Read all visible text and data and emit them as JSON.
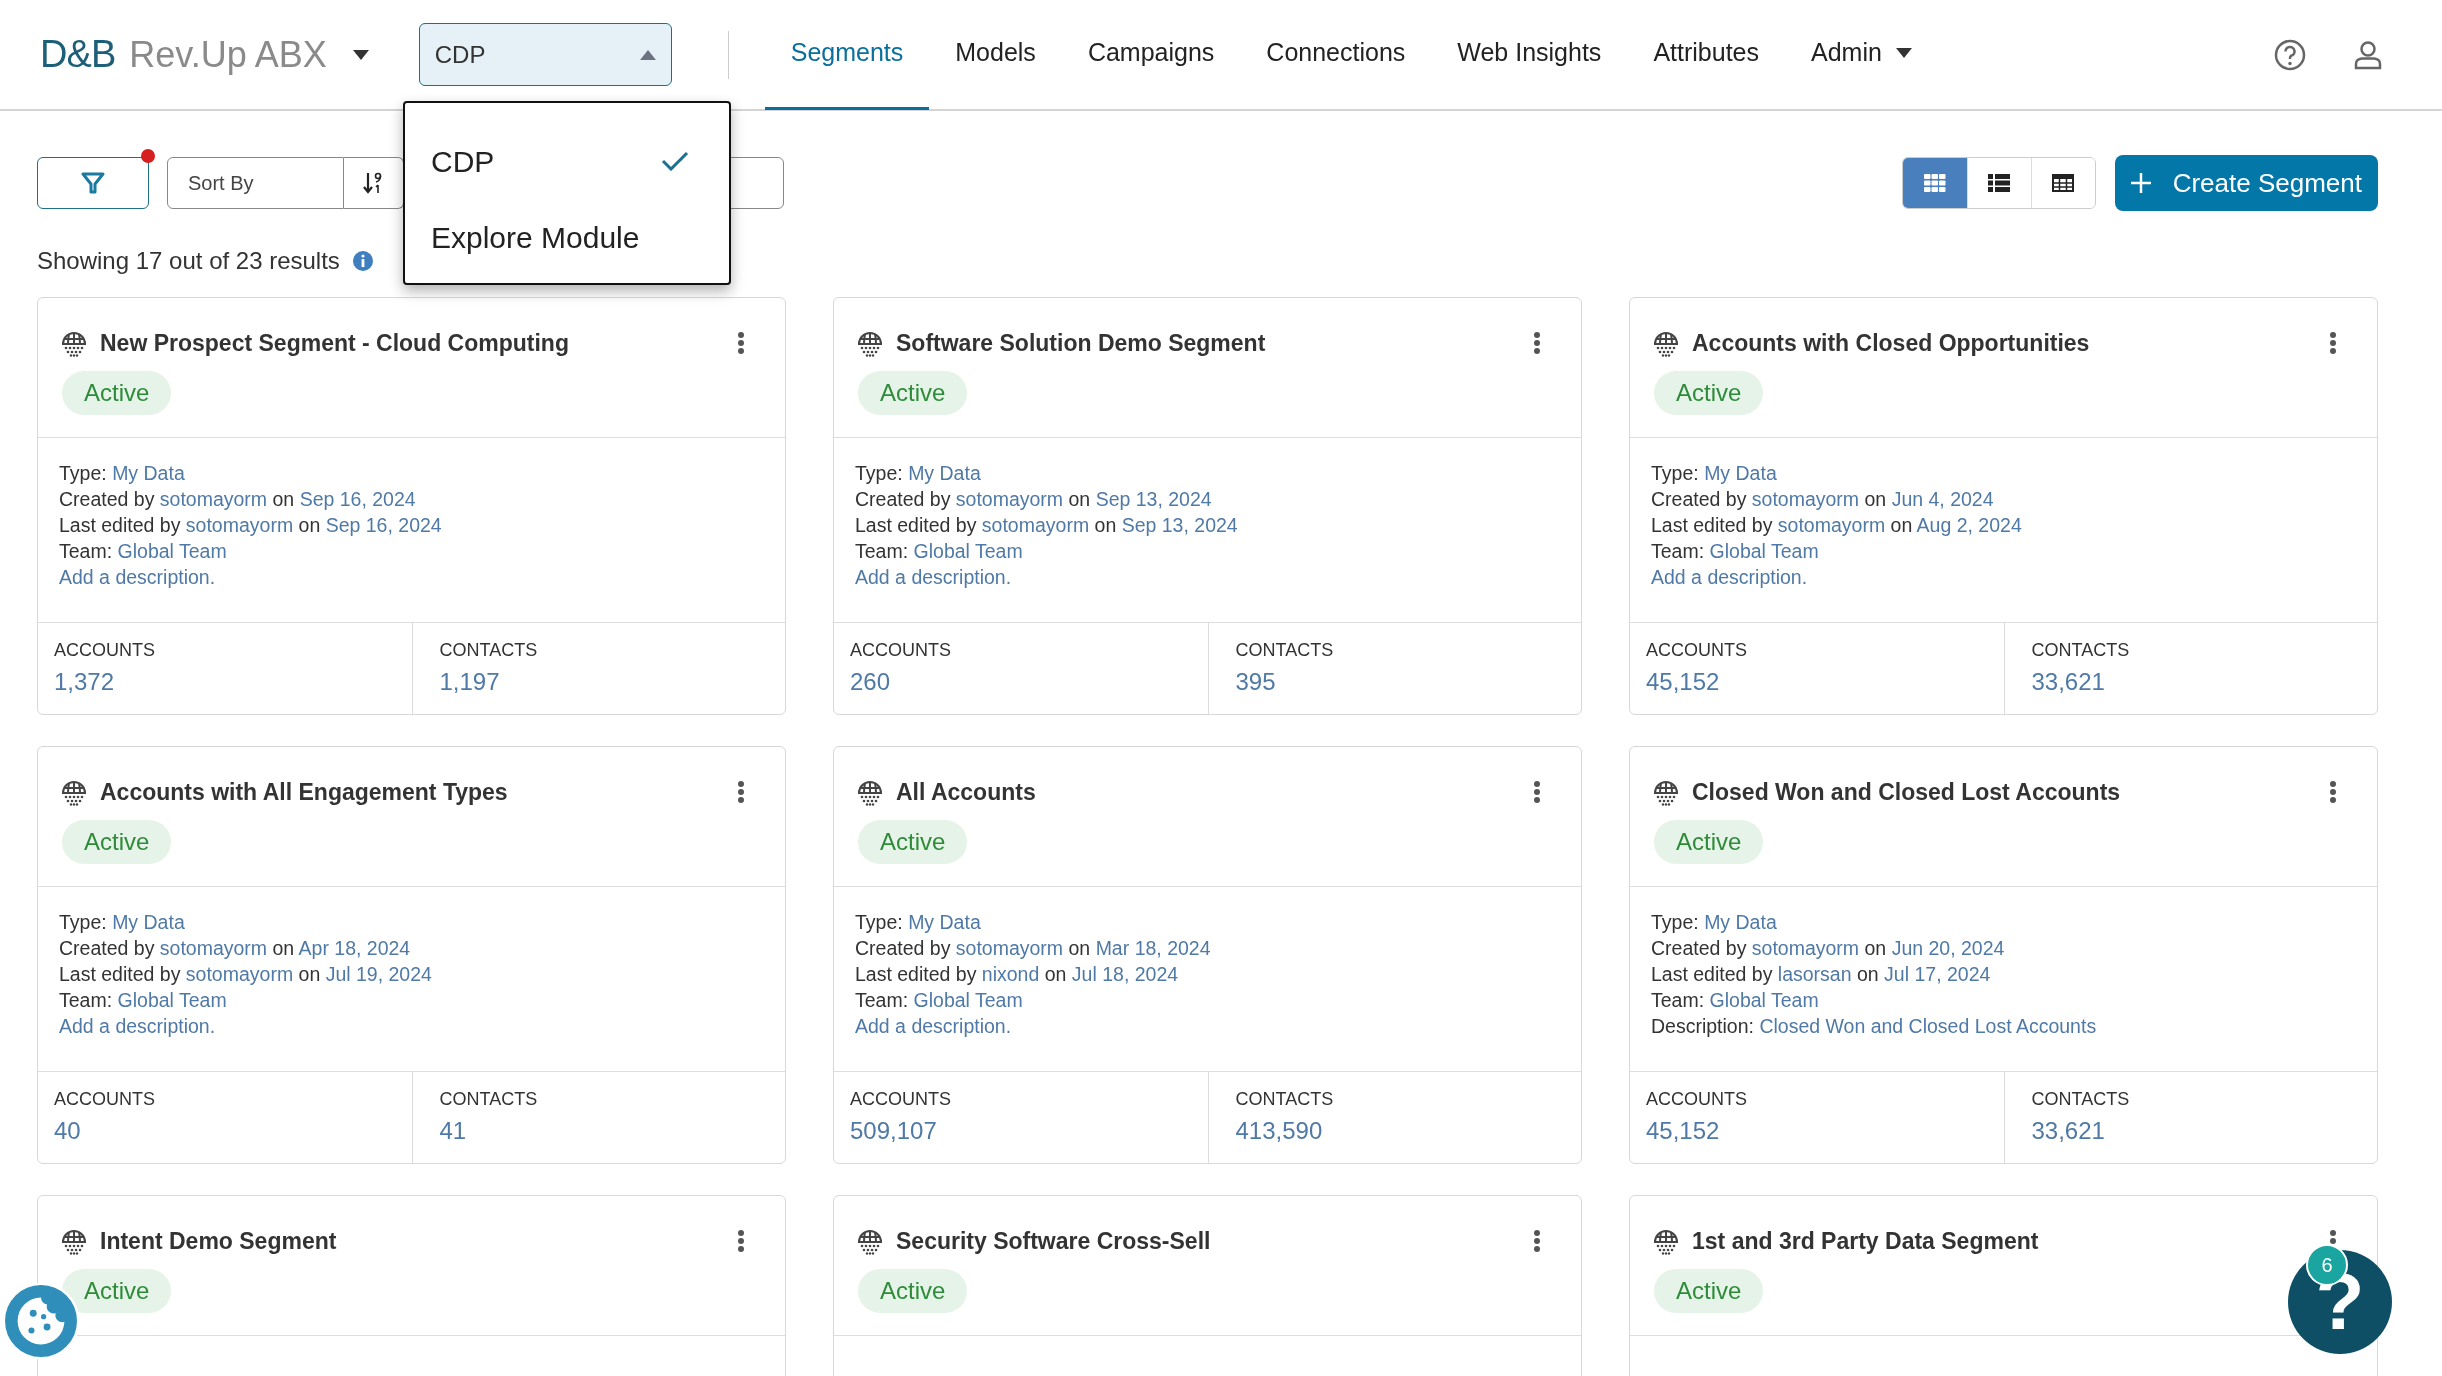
{
  "header": {
    "logo": {
      "mark": "D&B",
      "product": "Rev.Up ABX"
    },
    "module_select": {
      "value": "CDP",
      "expanded": true,
      "options": [
        {
          "label": "CDP",
          "selected": true
        },
        {
          "label": "Explore Module",
          "selected": false
        }
      ]
    },
    "nav": [
      {
        "label": "Segments",
        "selected": true,
        "kind": "link"
      },
      {
        "label": "Models",
        "selected": false,
        "kind": "link"
      },
      {
        "label": "Campaigns",
        "selected": false,
        "kind": "link"
      },
      {
        "label": "Connections",
        "selected": false,
        "kind": "link"
      },
      {
        "label": "Web Insights",
        "selected": false,
        "kind": "link"
      },
      {
        "label": "Attributes",
        "selected": false,
        "kind": "link"
      },
      {
        "label": "Admin",
        "selected": false,
        "kind": "menu"
      }
    ]
  },
  "toolbar": {
    "filter_active": true,
    "sort": {
      "placeholder": "Sort By"
    },
    "views": [
      {
        "kind": "grid",
        "selected": true
      },
      {
        "kind": "list",
        "selected": false
      },
      {
        "kind": "table",
        "selected": false
      }
    ],
    "create_button": "Create Segment"
  },
  "results": "Showing 17 out of 23 results",
  "cards": [
    {
      "title": "New Prospect Segment - Cloud Computing",
      "status": "Active",
      "lines": [
        [
          {
            "text": "Type: ",
            "kind": "text"
          },
          {
            "text": "My Data",
            "kind": "link"
          }
        ],
        [
          {
            "text": "Created by ",
            "kind": "text"
          },
          {
            "text": "sotomayorm",
            "kind": "link"
          },
          {
            "text": " on ",
            "kind": "text"
          },
          {
            "text": "Sep 16, 2024",
            "kind": "link"
          }
        ],
        [
          {
            "text": "Last edited by ",
            "kind": "text"
          },
          {
            "text": "sotomayorm",
            "kind": "link"
          },
          {
            "text": " on ",
            "kind": "text"
          },
          {
            "text": "Sep 16, 2024",
            "kind": "link"
          }
        ],
        [
          {
            "text": "Team: ",
            "kind": "text"
          },
          {
            "text": "Global Team",
            "kind": "link"
          }
        ],
        [
          {
            "text": "Add a description.",
            "kind": "link"
          }
        ]
      ],
      "stats": [
        {
          "label": "ACCOUNTS",
          "value": "1,372"
        },
        {
          "label": "CONTACTS",
          "value": "1,197"
        }
      ]
    },
    {
      "title": "Software Solution Demo Segment",
      "status": "Active",
      "lines": [
        [
          {
            "text": "Type: ",
            "kind": "text"
          },
          {
            "text": "My Data",
            "kind": "link"
          }
        ],
        [
          {
            "text": "Created by ",
            "kind": "text"
          },
          {
            "text": "sotomayorm",
            "kind": "link"
          },
          {
            "text": " on ",
            "kind": "text"
          },
          {
            "text": "Sep 13, 2024",
            "kind": "link"
          }
        ],
        [
          {
            "text": "Last edited by ",
            "kind": "text"
          },
          {
            "text": "sotomayorm",
            "kind": "link"
          },
          {
            "text": " on ",
            "kind": "text"
          },
          {
            "text": "Sep 13, 2024",
            "kind": "link"
          }
        ],
        [
          {
            "text": "Team: ",
            "kind": "text"
          },
          {
            "text": "Global Team",
            "kind": "link"
          }
        ],
        [
          {
            "text": "Add a description.",
            "kind": "link"
          }
        ]
      ],
      "stats": [
        {
          "label": "ACCOUNTS",
          "value": "260"
        },
        {
          "label": "CONTACTS",
          "value": "395"
        }
      ]
    },
    {
      "title": "Accounts with Closed Opportunities",
      "status": "Active",
      "lines": [
        [
          {
            "text": "Type: ",
            "kind": "text"
          },
          {
            "text": "My Data",
            "kind": "link"
          }
        ],
        [
          {
            "text": "Created by ",
            "kind": "text"
          },
          {
            "text": "sotomayorm",
            "kind": "link"
          },
          {
            "text": " on ",
            "kind": "text"
          },
          {
            "text": "Jun 4, 2024",
            "kind": "link"
          }
        ],
        [
          {
            "text": "Last edited by ",
            "kind": "text"
          },
          {
            "text": "sotomayorm",
            "kind": "link"
          },
          {
            "text": " on ",
            "kind": "text"
          },
          {
            "text": "Aug 2, 2024",
            "kind": "link"
          }
        ],
        [
          {
            "text": "Team: ",
            "kind": "text"
          },
          {
            "text": "Global Team",
            "kind": "link"
          }
        ],
        [
          {
            "text": "Add a description.",
            "kind": "link"
          }
        ]
      ],
      "stats": [
        {
          "label": "ACCOUNTS",
          "value": "45,152"
        },
        {
          "label": "CONTACTS",
          "value": "33,621"
        }
      ]
    },
    {
      "title": "Accounts with All Engagement Types",
      "status": "Active",
      "lines": [
        [
          {
            "text": "Type: ",
            "kind": "text"
          },
          {
            "text": "My Data",
            "kind": "link"
          }
        ],
        [
          {
            "text": "Created by ",
            "kind": "text"
          },
          {
            "text": "sotomayorm",
            "kind": "link"
          },
          {
            "text": " on ",
            "kind": "text"
          },
          {
            "text": "Apr 18, 2024",
            "kind": "link"
          }
        ],
        [
          {
            "text": "Last edited by ",
            "kind": "text"
          },
          {
            "text": "sotomayorm",
            "kind": "link"
          },
          {
            "text": " on ",
            "kind": "text"
          },
          {
            "text": "Jul 19, 2024",
            "kind": "link"
          }
        ],
        [
          {
            "text": "Team: ",
            "kind": "text"
          },
          {
            "text": "Global Team",
            "kind": "link"
          }
        ],
        [
          {
            "text": "Add a description.",
            "kind": "link"
          }
        ]
      ],
      "stats": [
        {
          "label": "ACCOUNTS",
          "value": "40"
        },
        {
          "label": "CONTACTS",
          "value": "41"
        }
      ]
    },
    {
      "title": "All Accounts",
      "status": "Active",
      "lines": [
        [
          {
            "text": "Type: ",
            "kind": "text"
          },
          {
            "text": "My Data",
            "kind": "link"
          }
        ],
        [
          {
            "text": "Created by ",
            "kind": "text"
          },
          {
            "text": "sotomayorm",
            "kind": "link"
          },
          {
            "text": " on ",
            "kind": "text"
          },
          {
            "text": "Mar 18, 2024",
            "kind": "link"
          }
        ],
        [
          {
            "text": "Last edited by ",
            "kind": "text"
          },
          {
            "text": "nixond",
            "kind": "link"
          },
          {
            "text": " on ",
            "kind": "text"
          },
          {
            "text": "Jul 18, 2024",
            "kind": "link"
          }
        ],
        [
          {
            "text": "Team: ",
            "kind": "text"
          },
          {
            "text": "Global Team",
            "kind": "link"
          }
        ],
        [
          {
            "text": "Add a description.",
            "kind": "link"
          }
        ]
      ],
      "stats": [
        {
          "label": "ACCOUNTS",
          "value": "509,107"
        },
        {
          "label": "CONTACTS",
          "value": "413,590"
        }
      ]
    },
    {
      "title": "Closed Won and Closed Lost Accounts",
      "status": "Active",
      "lines": [
        [
          {
            "text": "Type: ",
            "kind": "text"
          },
          {
            "text": "My Data",
            "kind": "link"
          }
        ],
        [
          {
            "text": "Created by ",
            "kind": "text"
          },
          {
            "text": "sotomayorm",
            "kind": "link"
          },
          {
            "text": " on ",
            "kind": "text"
          },
          {
            "text": "Jun 20, 2024",
            "kind": "link"
          }
        ],
        [
          {
            "text": "Last edited by ",
            "kind": "text"
          },
          {
            "text": "lasorsan",
            "kind": "link"
          },
          {
            "text": " on ",
            "kind": "text"
          },
          {
            "text": "Jul 17, 2024",
            "kind": "link"
          }
        ],
        [
          {
            "text": "Team: ",
            "kind": "text"
          },
          {
            "text": "Global Team",
            "kind": "link"
          }
        ],
        [
          {
            "text": "Description: ",
            "kind": "text"
          },
          {
            "text": "Closed Won and Closed Lost Accounts",
            "kind": "link"
          }
        ]
      ],
      "stats": [
        {
          "label": "ACCOUNTS",
          "value": "45,152"
        },
        {
          "label": "CONTACTS",
          "value": "33,621"
        }
      ]
    },
    {
      "title": "Intent Demo Segment",
      "status": "Active"
    },
    {
      "title": "Security Software Cross-Sell",
      "status": "Active"
    },
    {
      "title": "1st and 3rd Party Data Segment",
      "status": "Active"
    }
  ],
  "help_widget": {
    "glyph": "?",
    "badge": "6"
  }
}
